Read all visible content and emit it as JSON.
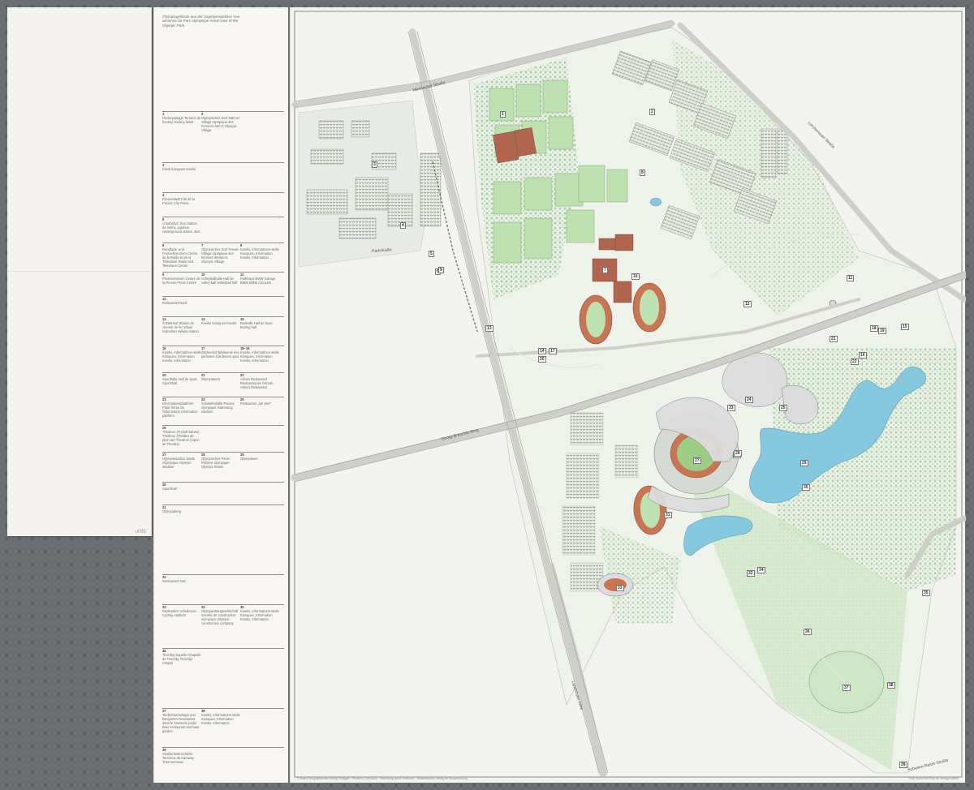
{
  "panel": {
    "stamp": "u095"
  },
  "intro": "Olympiagelände aus der Vogelperspektive Vue aérienne du Parc olympique Aerial view of the Olympic Park",
  "index_entries": [
    {
      "col": 0,
      "num": "1",
      "text": "Hockeyanlage Terrains de hockey Hockey fields"
    },
    {
      "col": 1,
      "num": "2",
      "text": "Olympisches Dorf Männer Village olympique des hommes Men's Olympic Village"
    },
    {
      "col": 0,
      "num": "3",
      "text": "Kiosk Kiosques Kiosks"
    },
    {
      "col": 0,
      "num": "4",
      "text": "Pressestadt Cité de la Presse City Press"
    },
    {
      "col": 0,
      "num": "5",
      "text": "U-Bahnhof, Bus Station de métro, autobus Underground station, Bus"
    },
    {
      "col": 0,
      "num": "6",
      "text": "Rundfunk- und Fernsehzentrum Centre de la Radio et de la Télévision Radio and Television Centre"
    },
    {
      "col": 1,
      "num": "7",
      "text": "Olympisches Dorf Frauen Village olympique des femmes Women's Olympic Village"
    },
    {
      "col": 2,
      "num": "8",
      "text": "Kiosks, Informations-stelle Kiosques, Information Kiosks, Information"
    },
    {
      "col": 0,
      "num": "9",
      "text": "Pressezentrum Centre de la Presse Press Centre"
    },
    {
      "col": 1,
      "num": "10",
      "text": "Volleyballhalle Hall de volley-ball Volleyball hall"
    },
    {
      "col": 2,
      "num": "11",
      "text": "Parkhaus BMW Garage BMW BMW Car park"
    },
    {
      "col": 0,
      "num": "12",
      "text": "Restaurant Nord"
    },
    {
      "col": 0,
      "num": "13",
      "text": "S-Bahnhof Station de chemin de fer urbain Suburban railway station"
    },
    {
      "col": 1,
      "num": "14",
      "text": "Kiosks Kiosques Kiosks"
    },
    {
      "col": 2,
      "num": "15",
      "text": "Boxhalle Hall de boxe Boxing hall"
    },
    {
      "col": 0,
      "num": "16",
      "text": "Kiosks, Informations-stelle Kiosques, Information Kiosks, Information"
    },
    {
      "col": 1,
      "num": "17",
      "text": "Gärtnerhof Bâtiments des jardiniers Gardeners yard"
    },
    {
      "col": 2,
      "num": "18–19",
      "text": "Kiosks, Informations-stelle Kiosques, Information Kiosks, Information"
    },
    {
      "col": 0,
      "num": "20",
      "text": "Sporthalle Hall de sport Sportshall"
    },
    {
      "col": 1,
      "num": "21",
      "text": "Olympiaturm"
    },
    {
      "col": 2,
      "num": "22",
      "text": "Atrium Restaurant Restaurant de l'Atrium Atrium Restaurant"
    },
    {
      "col": 0,
      "num": "23",
      "text": "Informationsplattform Plate-forme de l'information Information platform"
    },
    {
      "col": 1,
      "num": "24",
      "text": "Schwimmhalle Piscine olympique Swimming stadium"
    },
    {
      "col": 2,
      "num": "25",
      "text": "Restaurant „am See\""
    },
    {
      "col": 0,
      "num": "26",
      "text": "Theatron (Freiluft-bühne) Théâtron (Théâtre de plein air) Theatron (Open air Theatre)"
    },
    {
      "col": 0,
      "num": "27",
      "text": "Olympiastadion Stade Olympique Olympic stadium"
    },
    {
      "col": 1,
      "num": "28",
      "text": "Olympisches Feuer Flamme olympique Olympic Flame"
    },
    {
      "col": 2,
      "num": "29",
      "text": "Olympiasee"
    },
    {
      "col": 0,
      "num": "30",
      "text": "Sportinsel"
    },
    {
      "col": 0,
      "num": "31",
      "text": "Olympiaberg"
    },
    {
      "col": 0,
      "num": "32",
      "text": "Restaurant Süd"
    },
    {
      "col": 0,
      "num": "33",
      "text": "Radstadion Vélodrome Cycling stadium"
    },
    {
      "col": 1,
      "num": "34",
      "text": "Olympia-Baugesellschaft Société de construction olympique Olympic construction company"
    },
    {
      "col": 2,
      "num": "35",
      "text": "Kiosks, Informations-stelle Kiosques, Information Kiosks, Information"
    },
    {
      "col": 0,
      "num": "36",
      "text": "Tirschky-Kapelle Chapelle de Tirschky Tirschky-Chapel"
    },
    {
      "col": 0,
      "num": "37",
      "text": "Tierbühnenanlage und Biergarten Restaurant dans le brasserie jardin Beer-restaurant and beer garden"
    },
    {
      "col": 1,
      "num": "38",
      "text": "Kiosks, Informations-stelle Kiosques, Information Kiosks, Information"
    },
    {
      "col": 0,
      "num": "39",
      "text": "Straßenbahnschleife Terminus de tramway Tram terminus"
    }
  ],
  "map": {
    "streets": {
      "lerchenauer": "Lerchenauer Straße",
      "georg_brauchle": "Georg-Brauchle-Ring",
      "landshuter": "Landshuter Allee",
      "schwere_reiter": "Schwere-Reiter-Straße",
      "frankfurter_ring": "Frankfurter Ring",
      "moosacher": "Moosacher Straße",
      "parkstraße": "Parkstraße"
    },
    "numbers": [
      "1",
      "2",
      "3",
      "4",
      "5",
      "6",
      "7",
      "8",
      "9",
      "10",
      "11",
      "12",
      "13",
      "14",
      "15",
      "16",
      "17",
      "18",
      "19",
      "20",
      "21",
      "22",
      "23",
      "24",
      "25",
      "26",
      "27",
      "28",
      "29",
      "30",
      "31",
      "32",
      "33",
      "34",
      "35",
      "36",
      "37",
      "38",
      "39"
    ],
    "imprint_left": "© Mairs Geographischer Verlag Stuttgart · Printed in Germany · Zeichnung durch Hofmann · Süddeutscher Verlag für Bauzeichnung",
    "imprint_right": "Foto: Nord-Kiel-Foto für Verlag/Luftbild"
  }
}
